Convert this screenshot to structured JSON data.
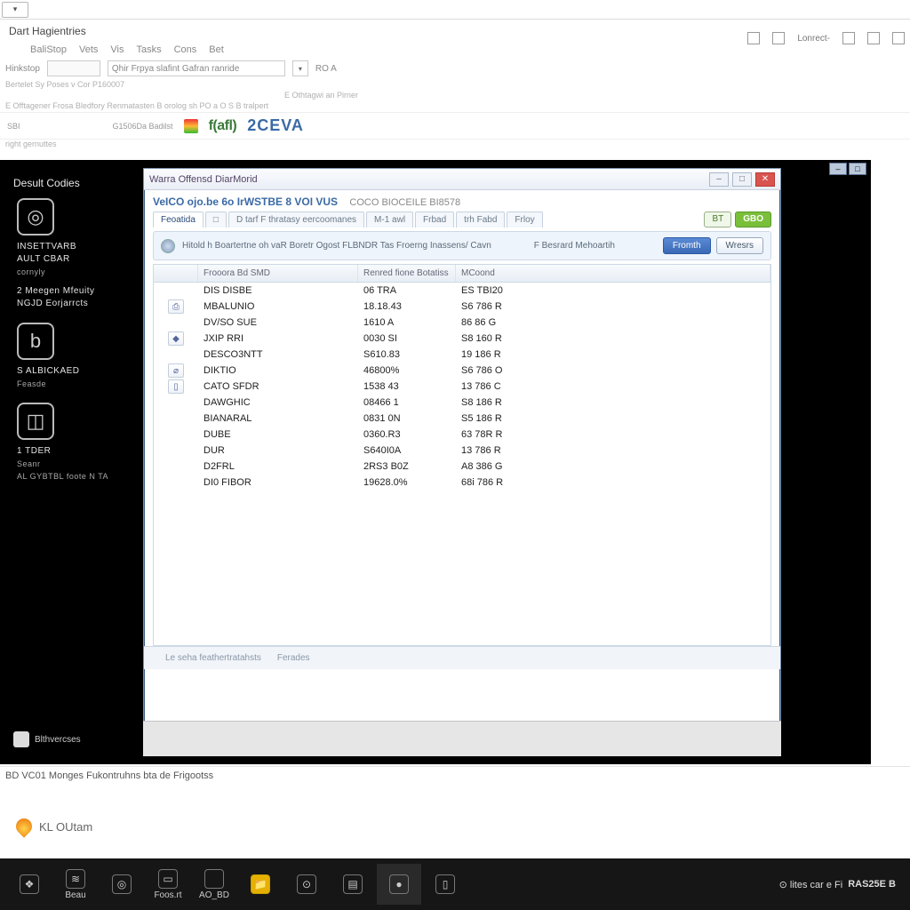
{
  "app": {
    "title": "Dart Hagientries",
    "menus": [
      "BaliStop",
      "Vets",
      "Vis",
      "Tasks",
      "Cons",
      "Bet"
    ],
    "quick_label": "Hinkstop",
    "quick_field": "Qhir Frpya slafint Gafran ranride",
    "quick_right": "RO A",
    "meta1": "Bertelet Sy Poses v Cor P160007",
    "meta2": "E Offtagener Frosa Bledfory Renmatasten B orolog sh PO a O S B tralpert",
    "meta3": "E Othtagwi an Pirner",
    "brand_small": "SBI",
    "brand1": "f(afl)",
    "brand2": "2CEVA",
    "rowlabel1": "G1506Da Badilst",
    "rowlabel2": "right gernuttes",
    "topright_label": "Lonrect-"
  },
  "sidebar": {
    "title": "Desult Codies",
    "items": [
      {
        "glyph": "◎",
        "l1": "INSETTVARB",
        "l2": "AULT CBAR",
        "sub": "cornyly"
      },
      {
        "glyph": "",
        "l1": "2  Meegen Mfeuity",
        "l2": "NGJD Eorjarrcts",
        "sub": ""
      },
      {
        "glyph": "b",
        "l1": "S  ALBICKAED",
        "l2": "Feasde",
        "sub": ""
      },
      {
        "glyph": "◫",
        "l1": "1  TDER",
        "l2": "Seanr",
        "sub": "AL GYBTBL foote  N TA"
      }
    ],
    "footer": "Blthvercses"
  },
  "modal": {
    "title": "Warra Offensd DiarMorid",
    "heading": "VeICO  ojo.be 6o IrWSTBE 8 VOI VUS",
    "heading_extra": "COCO BIOCEILE BI8578",
    "tabs": [
      "Feoatida",
      "□",
      "D tarf F thratasy eercoomanes",
      "M-1 awl",
      "Frbad",
      "trh Fabd",
      "Frloy"
    ],
    "pill1": "BT",
    "pill2": "GBO",
    "info_text": "Hitold h Boartertne oh vaR Boretr Ogost FLBNDR Tas Froerng Inassens/ Cavn",
    "info_right": "F Besrard Mehoartih",
    "btn_primary": "Fromth",
    "btn_secondary": "Wresrs",
    "columns": [
      "",
      "Frooora Bd SMD",
      "Renred fione Botatiss",
      "MCoond"
    ],
    "rows": [
      {
        "ico": "",
        "a": "DIS DISBE",
        "b": "06 TRA",
        "c": "ES TBI20"
      },
      {
        "ico": "⎙",
        "a": "MBALUNIO",
        "b": "18.18.43",
        "c": "S6 786 R"
      },
      {
        "ico": "",
        "a": "DV/SO SUE",
        "b": "1610  A",
        "c": "86 86 G"
      },
      {
        "ico": "◆",
        "a": "JXIP RRI",
        "b": "0030 SI",
        "c": "S8 160  R"
      },
      {
        "ico": "",
        "a": "DESCO3NTT",
        "b": "S610.83",
        "c": "19 186  R"
      },
      {
        "ico": "⌀",
        "a": "DIKTIO",
        "b": "46800%",
        "c": "S6 786  O"
      },
      {
        "ico": "▯",
        "a": "CATO SFDR",
        "b": "1538 43",
        "c": "13 786  C"
      },
      {
        "ico": "",
        "a": "DAWGHIC",
        "b": "08466 1",
        "c": "S8 186  R"
      },
      {
        "ico": "",
        "a": "BIANARAL",
        "b": "0831 0N",
        "c": "S5 186  R"
      },
      {
        "ico": "",
        "a": "DUBE",
        "b": "0360.R3",
        "c": "63 78R  R"
      },
      {
        "ico": "",
        "a": "DUR",
        "b": "S640I0A",
        "c": "13 786  R"
      },
      {
        "ico": "",
        "a": "D2FRL",
        "b": "2RS3 B0Z",
        "c": "A8 386  G"
      },
      {
        "ico": "",
        "a": "DI0 FIBOR",
        "b": "19628.0%",
        "c": "68i 786 R"
      }
    ],
    "footer_left": "Le seha feathertratahsts",
    "footer_right": "Ferades"
  },
  "status": "BD VC01 Monges Fukontruhns bta de Frigootss",
  "bottom": {
    "label": "KL OUtam"
  },
  "taskbar": {
    "items": [
      {
        "glyph": "❖",
        "label": ""
      },
      {
        "glyph": "≋",
        "label": "Beau"
      },
      {
        "glyph": "◎",
        "label": ""
      },
      {
        "glyph": "▭",
        "label": "Foos.rt"
      },
      {
        "glyph": "",
        "label": "AO_BD"
      },
      {
        "glyph": "📁",
        "label": "",
        "hl": true
      },
      {
        "glyph": "⊙",
        "label": ""
      },
      {
        "glyph": "▤",
        "label": ""
      },
      {
        "glyph": "●",
        "label": "",
        "active": true
      },
      {
        "glyph": "▯",
        "label": ""
      }
    ],
    "clock_pre": "⊙ lites car e Fi",
    "clock": "RAS25E B"
  }
}
